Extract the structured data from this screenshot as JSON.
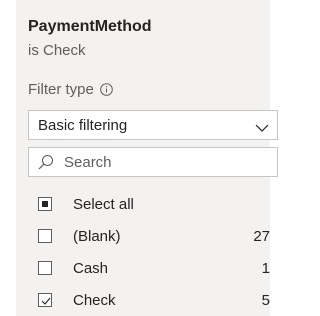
{
  "filter": {
    "field_name": "PaymentMethod",
    "condition": "is Check",
    "filter_type_label": "Filter type",
    "filter_type_value": "Basic filtering",
    "search_placeholder": "Search",
    "items": [
      {
        "label": "Select all",
        "count": "",
        "state": "indeterminate"
      },
      {
        "label": "(Blank)",
        "count": "27",
        "state": "unchecked"
      },
      {
        "label": "Cash",
        "count": "1",
        "state": "unchecked"
      },
      {
        "label": "Check",
        "count": "5",
        "state": "checked"
      }
    ]
  },
  "icons": {
    "info": "info-icon",
    "dropdown": "chevron-down-icon",
    "search": "search-icon",
    "check": "check-icon"
  }
}
